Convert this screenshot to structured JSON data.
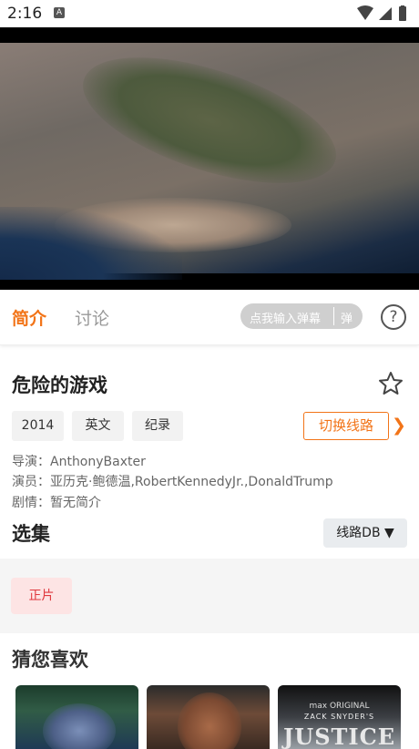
{
  "status_bar": {
    "time": "2:16",
    "notification_icon": "A",
    "icons": [
      "wifi-icon",
      "signal-icon",
      "battery-icon"
    ]
  },
  "tabs": {
    "intro": "简介",
    "discuss": "讨论"
  },
  "danmu": {
    "input_placeholder": "点我输入弹幕",
    "button": "弹"
  },
  "movie": {
    "title": "危险的游戏",
    "tags": [
      "2014",
      "英文",
      "纪录"
    ],
    "switch_route": "切换线路",
    "director": "导演：AnthonyBaxter",
    "cast": "演员：亚历克·鲍德温,RobertKennedyJr.,DonaldTrump",
    "plot": "剧情：暂无简介"
  },
  "episodes": {
    "title": "选集",
    "route_label": "线路DB ▼",
    "items": [
      "正片"
    ]
  },
  "recommend": {
    "title": "猜您喜欢",
    "poster3_brand": "max ORIGINAL",
    "poster3_sub": "ZACK SNYDER'S",
    "poster3_title": "JUSTICE LEAGUE"
  },
  "colors": {
    "accent": "#f27418",
    "episode_text": "#e0393e"
  }
}
